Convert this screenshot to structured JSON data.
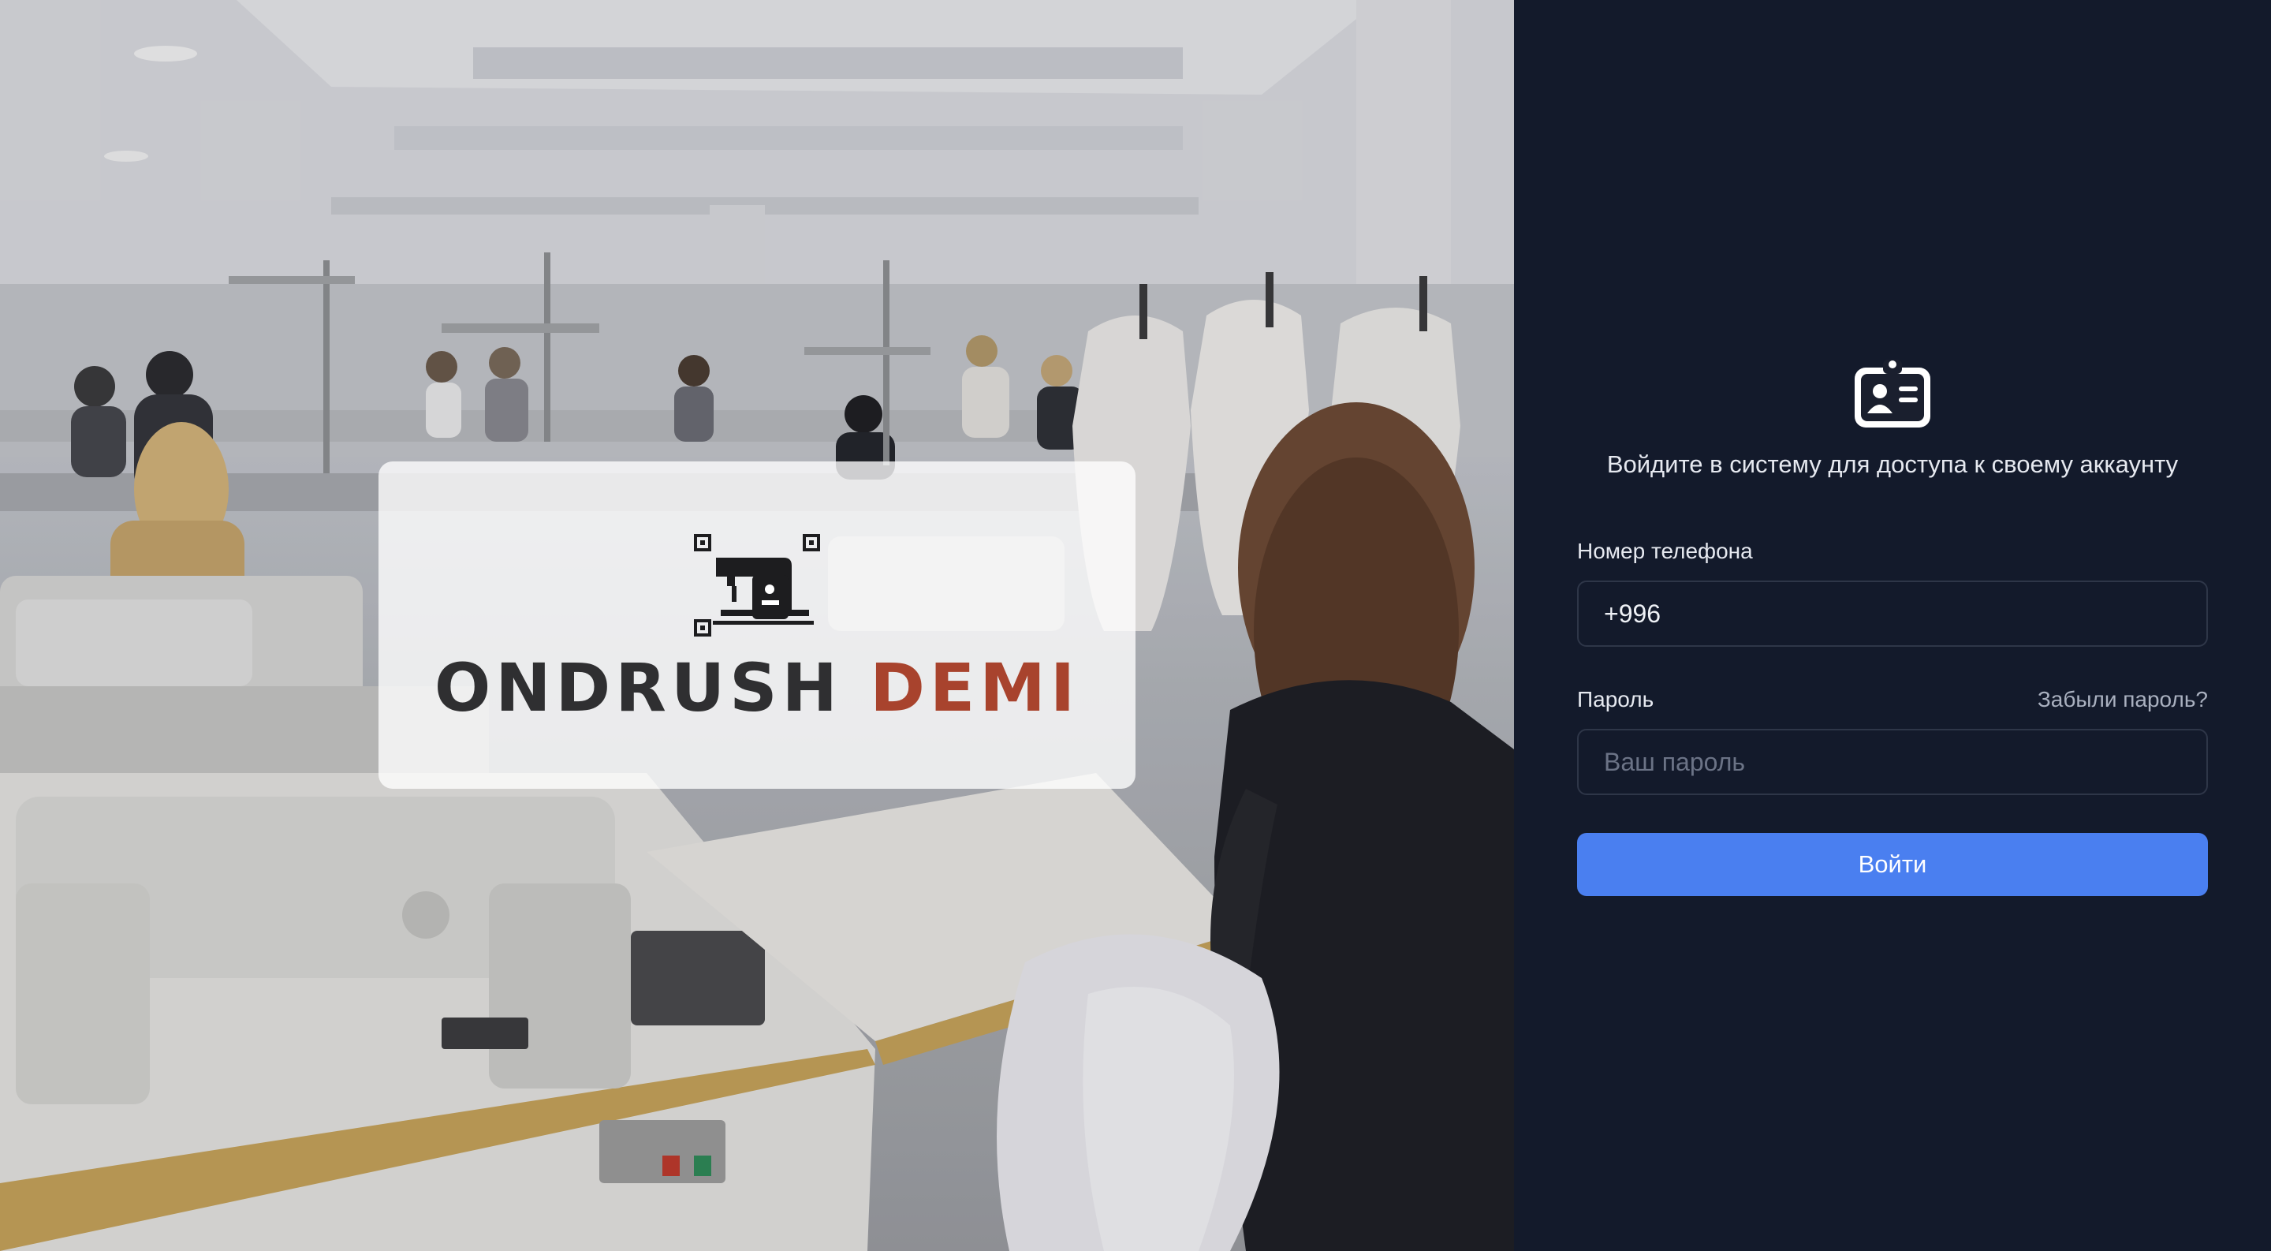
{
  "hero": {
    "logo": {
      "word1": "ONDRUSH",
      "word2": "DEMI",
      "icon": "sewing-machine-icon",
      "accent_color": "#a8432d"
    }
  },
  "login": {
    "icon": "id-card-icon",
    "subtitle": "Войдите в систему для доступа к своему аккаунту",
    "phone": {
      "label": "Номер телефона",
      "value": "+996"
    },
    "password": {
      "label": "Пароль",
      "placeholder": "Ваш пароль",
      "forgot": "Забыли пароль?"
    },
    "submit_label": "Войти",
    "accent_color": "#4a7ff0"
  }
}
